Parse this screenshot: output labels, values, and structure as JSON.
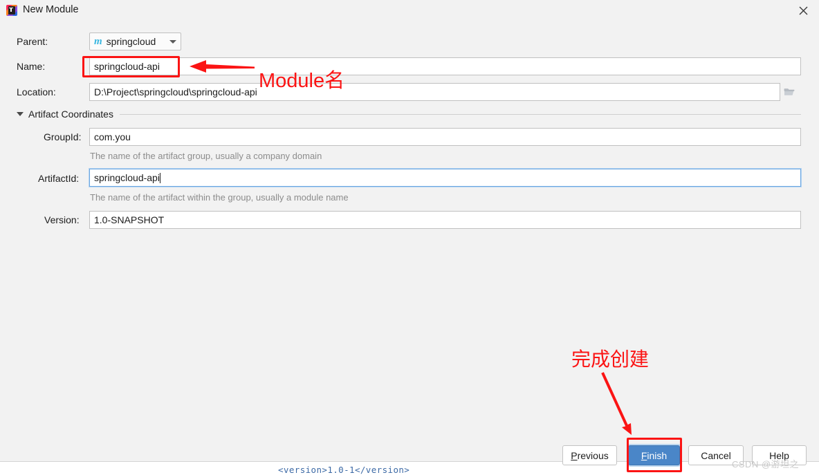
{
  "window": {
    "title": "New Module",
    "app_icon": "intellij-idea-icon",
    "close_icon": "close-icon"
  },
  "form": {
    "parent": {
      "label": "Parent:",
      "value": "springcloud",
      "icon": "maven-module-icon",
      "caret_icon": "chevron-down-icon"
    },
    "name": {
      "label": "Name:",
      "value": "springcloud-api",
      "placeholder": ""
    },
    "location": {
      "label": "Location:",
      "value": "D:\\Project\\springcloud\\springcloud-api",
      "placeholder": "",
      "browse_icon": "folder-open-icon"
    },
    "artifact_section": {
      "label": "Artifact Coordinates",
      "expanded": true,
      "toggle_icon": "triangle-down-icon"
    },
    "group_id": {
      "label": "GroupId:",
      "value": "com.you",
      "hint": "The name of the artifact group, usually a company domain"
    },
    "artifact_id": {
      "label": "ArtifactId:",
      "value": "springcloud-api",
      "hint": "The name of the artifact within the group, usually a module name",
      "focused": true
    },
    "version": {
      "label": "Version:",
      "value": "1.0-SNAPSHOT"
    }
  },
  "buttons": {
    "previous": {
      "label": "Previous",
      "mnemonic": "P"
    },
    "finish": {
      "label": "Finish",
      "mnemonic": "F",
      "primary": true
    },
    "cancel": {
      "label": "Cancel",
      "mnemonic": ""
    },
    "help": {
      "label": "Help",
      "mnemonic": ""
    }
  },
  "annotations": {
    "color": "#fb1414",
    "name_label": "Module名",
    "finish_label": "完成创建",
    "name_arrow_icon": "arrow-left-icon",
    "finish_arrow_icon": "arrow-down-right-icon",
    "name_box_icon": "highlight-box",
    "finish_box_icon": "highlight-box"
  },
  "background": {
    "xml_line": "<version>1.0-1</version>"
  },
  "watermark": "CSDN @游坦之"
}
